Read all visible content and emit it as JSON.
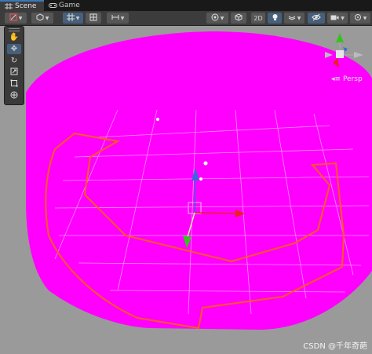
{
  "tabs": [
    {
      "label": "Scene",
      "icon": "scene-grid-icon",
      "active": true
    },
    {
      "label": "Game",
      "icon": "gamepad-icon",
      "active": false
    }
  ],
  "toolbar": {
    "mode_2d_label": "2D",
    "buttons": [
      "shading-mode-icon",
      "draw-mode-icon",
      "pivot-icon",
      "grid-snap-icon",
      "render-sphere-icon",
      "gizmo-cube-icon",
      "lighting-icon",
      "audio-icon",
      "effects-icon",
      "visibility-icon",
      "camera-icon",
      "gizmos-icon"
    ]
  },
  "tool_palette": [
    "hand-tool-icon",
    "move-tool-icon",
    "rotate-tool-icon",
    "scale-tool-icon",
    "rect-tool-icon",
    "transform-tool-icon"
  ],
  "orientation_gizmo": {
    "projection_label": "Persp"
  },
  "watermark": "CSDN @千年奇葩",
  "colors": {
    "magenta_surface": "#ff00ff",
    "outline_orange": "#ff6020",
    "axis_x": "#e8221e",
    "axis_y": "#3a67e0",
    "axis_z": "#35c21f",
    "selected": "#46607c"
  }
}
